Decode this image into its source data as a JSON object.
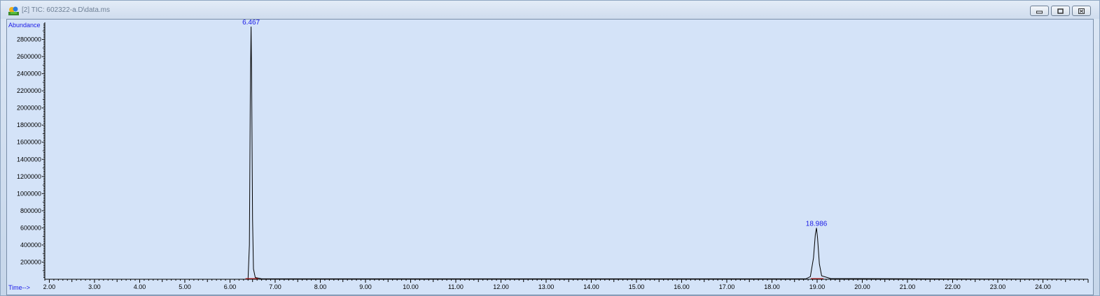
{
  "window": {
    "title": "[2] TIC: 602322-a.D\\data.ms",
    "icon": "chromatogram-app-icon",
    "buttons": [
      "minimize",
      "restore",
      "close"
    ]
  },
  "chart_data": {
    "type": "line",
    "ylabel": "Abundance",
    "xlabel": "Time-->",
    "xlim": [
      1.9,
      25.0
    ],
    "ylim": [
      0,
      3000000
    ],
    "x_ticks": [
      "2.00",
      "3.00",
      "4.00",
      "5.00",
      "6.00",
      "7.00",
      "8.00",
      "9.00",
      "10.00",
      "11.00",
      "12.00",
      "13.00",
      "14.00",
      "15.00",
      "16.00",
      "17.00",
      "18.00",
      "19.00",
      "20.00",
      "21.00",
      "22.00",
      "23.00",
      "24.00"
    ],
    "y_ticks": [
      "200000",
      "400000",
      "600000",
      "800000",
      "1000000",
      "1200000",
      "1400000",
      "1600000",
      "1800000",
      "2000000",
      "2200000",
      "2400000",
      "2600000",
      "2800000"
    ],
    "peaks": [
      {
        "label": "6.467",
        "time": 6.467,
        "abundance": 2950000
      },
      {
        "label": "18.986",
        "time": 18.986,
        "abundance": 600000
      }
    ],
    "series": [
      {
        "points": [
          [
            1.9,
            0
          ],
          [
            6.4,
            0
          ],
          [
            6.43,
            400000
          ],
          [
            6.45,
            2150000
          ],
          [
            6.467,
            2950000
          ],
          [
            6.48,
            2300000
          ],
          [
            6.5,
            700000
          ],
          [
            6.52,
            120000
          ],
          [
            6.56,
            20000
          ],
          [
            6.7,
            5000
          ],
          [
            8.3,
            5000
          ],
          [
            18.75,
            5000
          ],
          [
            18.85,
            30000
          ],
          [
            18.92,
            250000
          ],
          [
            18.96,
            520000
          ],
          [
            18.986,
            600000
          ],
          [
            19.01,
            480000
          ],
          [
            19.05,
            180000
          ],
          [
            19.1,
            40000
          ],
          [
            19.3,
            8000
          ],
          [
            25.0,
            0
          ]
        ]
      }
    ],
    "colors": {
      "trace": "#000000",
      "peak_label": "#1a1ae6",
      "baseline_marker": "#d02020",
      "plot_background": "#d4e3f8"
    }
  }
}
